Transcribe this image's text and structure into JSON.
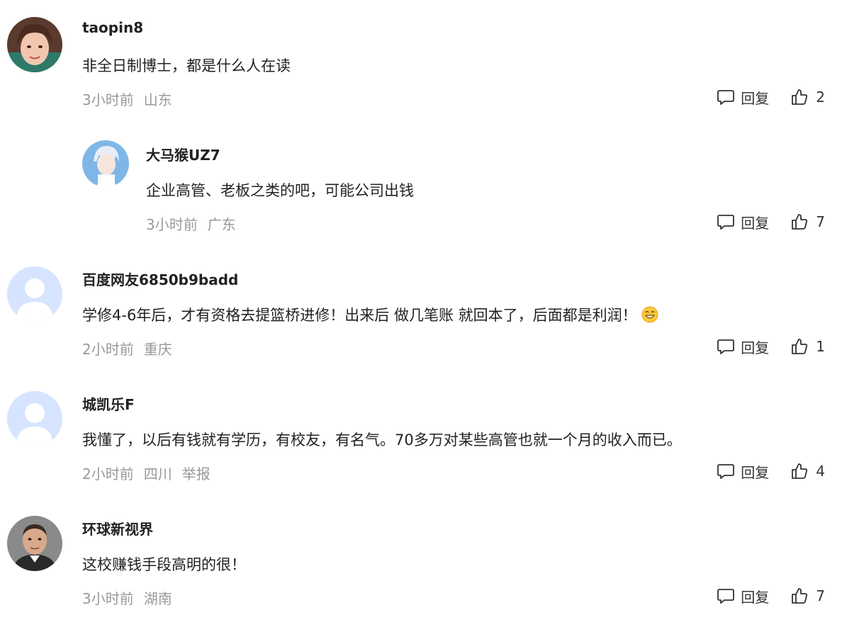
{
  "comments": [
    {
      "username": "taopin8",
      "text": "非全日制博士，都是什么人在读",
      "time": "3小时前",
      "location": "山东",
      "report": "",
      "reply_label": "回复",
      "likes": "2",
      "avatar": "photo-woman"
    },
    {
      "username": "大马猴UZ7",
      "text": "企业高管、老板之类的吧，可能公司出钱",
      "time": "3小时前",
      "location": "广东",
      "report": "",
      "reply_label": "回复",
      "likes": "7",
      "avatar": "anime-character"
    },
    {
      "username": "百度网友6850b9badd",
      "text": "学修4-6年后，才有资格去提篮桥进修！出来后 做几笔账 就回本了，后面都是利润！",
      "time": "2小时前",
      "location": "重庆",
      "report": "",
      "reply_label": "回复",
      "likes": "1",
      "avatar": "default-user",
      "emoji": "grinning-face-emoji"
    },
    {
      "username": "城凯乐F",
      "text": "我懂了，以后有钱就有学历，有校友，有名气。70多万对某些高管也就一个月的收入而已。",
      "time": "2小时前",
      "location": "四川",
      "report": "举报",
      "reply_label": "回复",
      "likes": "4",
      "avatar": "default-user"
    },
    {
      "username": "环球新视界",
      "text": "这校赚钱手段高明的很！",
      "time": "3小时前",
      "location": "湖南",
      "report": "",
      "reply_label": "回复",
      "likes": "7",
      "avatar": "photo-man"
    }
  ],
  "colors": {
    "text": "#222222",
    "meta": "#999999",
    "default_avatar_bg": "#d6e4ff",
    "default_avatar_fg": "#ffffff"
  }
}
